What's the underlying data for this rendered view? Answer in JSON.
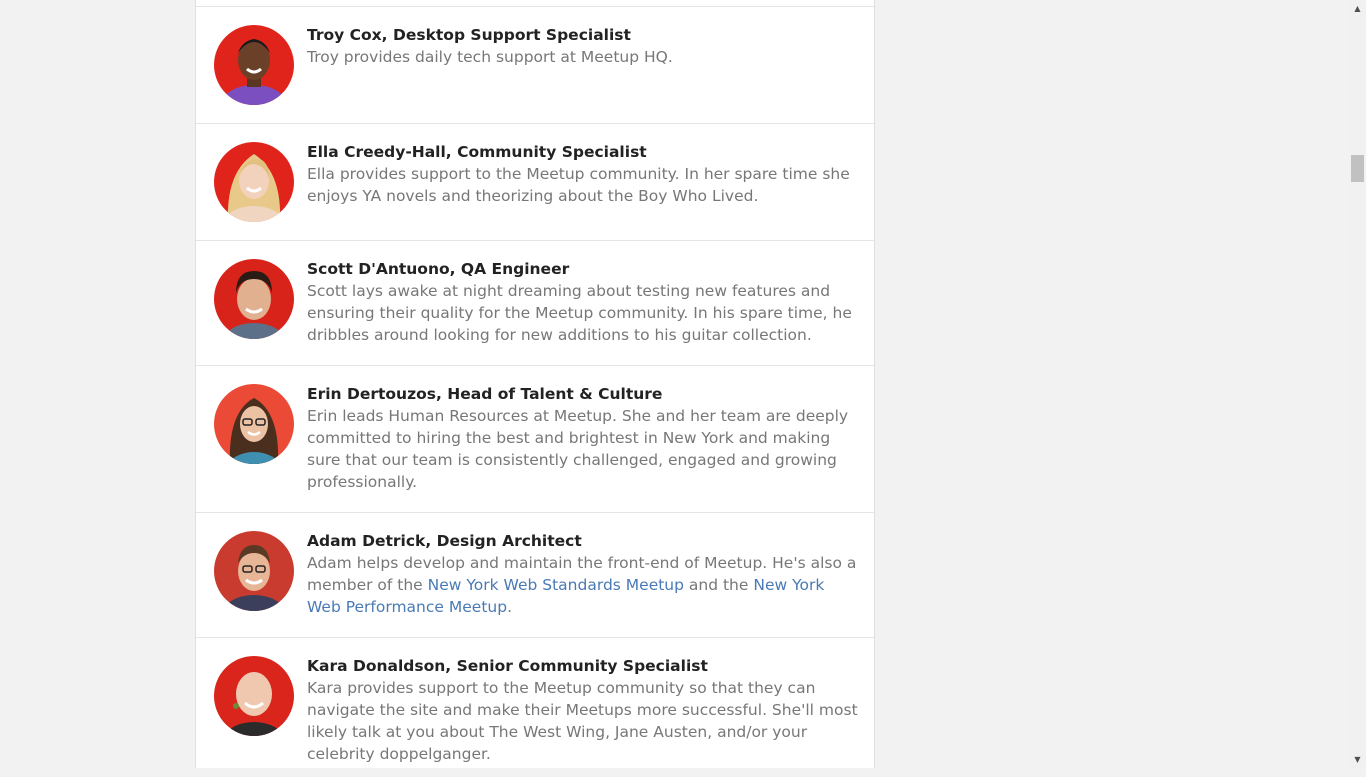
{
  "members": [
    {
      "name": "Troy Cox, Desktop Support Specialist",
      "bio": "Troy provides daily tech support at Meetup HQ."
    },
    {
      "name": "Ella Creedy-Hall, Community Specialist",
      "bio": "Ella provides support to the Meetup community. In her spare time she enjoys YA novels and theorizing about the Boy Who Lived."
    },
    {
      "name": "Scott D'Antuono, QA Engineer",
      "bio": "Scott lays awake at night dreaming about testing new features and ensuring their quality for the Meetup community. In his spare time, he dribbles around looking for new additions to his guitar collection."
    },
    {
      "name": "Erin Dertouzos, Head of Talent & Culture",
      "bio": "Erin leads Human Resources at Meetup. She and her team are deeply committed to hiring the best and brightest in New York and making sure that our team is consistently challenged, engaged and growing professionally."
    },
    {
      "name": "Adam Detrick, Design Architect",
      "bio_before": "Adam helps develop and maintain the front-end of Meetup. He's also a member of the ",
      "link1": "New York Web Standards Meetup",
      "bio_middle": " and the ",
      "link2": "New York Web Performance Meetup",
      "bio_after": "."
    },
    {
      "name": "Kara Donaldson, Senior Community Specialist",
      "bio": "Kara provides support to the Meetup community so that they can navigate the site and make their Meetups more successful. She'll most likely talk at you about The West Wing, Jane Austen, and/or your celebrity doppelganger."
    }
  ],
  "scrollbar": {
    "up_icon": "scroll-up-arrow",
    "down_icon": "scroll-down-arrow"
  },
  "colors": {
    "avatar_bg": "#e0241b",
    "link": "#4a7ab5",
    "name": "#222222",
    "bio": "#777777"
  }
}
